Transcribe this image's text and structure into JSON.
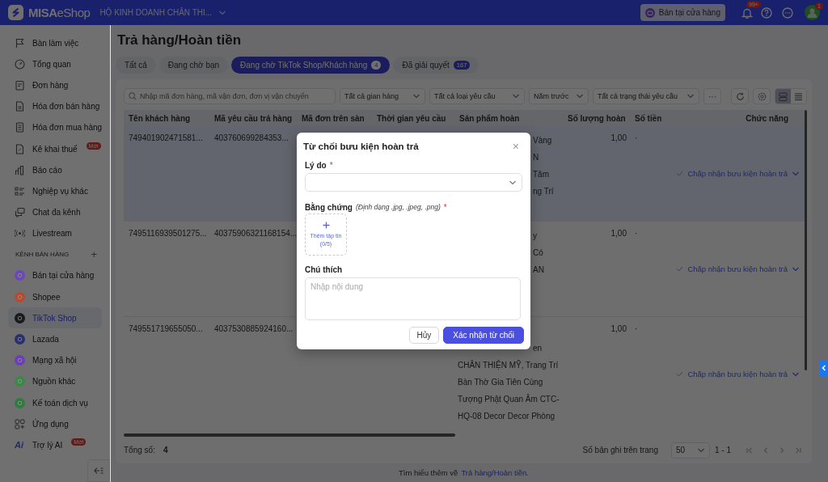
{
  "topbar": {
    "brand": "**MISA**eShop",
    "business": "HỘ KINH DOANH CHÂN THI...",
    "store_button": "Bán tại cửa hàng",
    "notification_count": "99+",
    "avatar_badge": "1"
  },
  "sidebar": {
    "items": [
      {
        "label": "Bàn làm việc",
        "selected": false
      },
      {
        "label": "Tổng quan",
        "selected": false
      },
      {
        "label": "Đơn hàng",
        "selected": false
      },
      {
        "label": "Hóa đơn bán hàng",
        "selected": false
      },
      {
        "label": "Hóa đơn mua hàng",
        "selected": false
      },
      {
        "label": "Kê khai thuế",
        "selected": false,
        "badge": "Mới"
      },
      {
        "label": "Báo cáo",
        "selected": false
      },
      {
        "label": "Nghiệp vụ khác",
        "selected": false
      },
      {
        "label": "Chat đa kênh",
        "selected": false
      },
      {
        "label": "Livestream",
        "selected": false
      }
    ],
    "section_label": "KÊNH BÁN HÀNG",
    "section_action": "+",
    "channels": [
      {
        "label": "Bán tại cửa hàng",
        "kind": "channel",
        "color": "#6b48b8",
        "selected": false
      },
      {
        "label": "Shopee",
        "kind": "channel",
        "color": "#b84a30",
        "selected": false
      },
      {
        "label": "TikTok Shop",
        "kind": "channel",
        "color": "#1a1a1a",
        "selected": true
      },
      {
        "label": "Lazada",
        "kind": "channel",
        "color": "#2a2f6e",
        "selected": false
      },
      {
        "label": "Mạng xã hội",
        "kind": "channel",
        "color": "#6c3fb8",
        "selected": false
      },
      {
        "label": "Nguồn khác",
        "kind": "channel",
        "color": "#3a8a45",
        "selected": false
      },
      {
        "label": "Kế toán dịch vụ",
        "kind": "channel",
        "color": "#2f7d3e",
        "selected": false
      },
      {
        "label": "Ứng dụng",
        "kind": "apps",
        "selected": false
      },
      {
        "label": "Trợ lý AI",
        "kind": "ai",
        "icon_text": "Ai",
        "selected": false,
        "badge": "Mới"
      }
    ]
  },
  "page": {
    "title": "Trả hàng/Hoàn tiền",
    "tabs": [
      {
        "label": "Tất cả",
        "selected": false
      },
      {
        "label": "Đang chờ bạn",
        "selected": false
      },
      {
        "label": "Đang chờ TikTok Shop/Khách hàng",
        "count": "4",
        "selected": true
      },
      {
        "label": "Đã giải quyết",
        "count": "167",
        "selected": false
      }
    ],
    "filters": {
      "search_placeholder": "Nhập mã đơn hàng, mã vận đơn, đơn vị vận chuyển",
      "selects": [
        "Tất cả gian hàng",
        "Tất cả loại yêu cầu",
        "Năm trước",
        "Tất cả trạng thái yêu cầu"
      ],
      "more": "···"
    },
    "view_modes": [
      {
        "selected": true
      },
      {
        "selected": false
      }
    ],
    "table": {
      "columns": [
        "Tên khách hàng",
        "Mã yêu cầu trả hàng",
        "Mã đơn trên sàn",
        "Thời gian yêu cầu",
        "Sản phẩm hoàn",
        "Số lượng hoàn",
        "Số tiền",
        "Chức năng"
      ],
      "rows": [
        {
          "selected": true,
          "customer": "749401902471581...",
          "request_id": "403760699284353...",
          "product_lines": [
            {
              "text": "Vàng",
              "kind": "fragment"
            },
            {
              "text": "N",
              "kind": "fragment"
            },
            {
              "text": "Tâm",
              "kind": "fragment"
            },
            {
              "text": "ng Trí",
              "kind": "fragment"
            }
          ],
          "quantity": "1,00",
          "amount": "·",
          "action": "Chấp nhận bưu kiện hoàn trả"
        },
        {
          "selected": false,
          "customer": "7495116939501275...",
          "request_id": "40375906321168154...",
          "product_lines": [
            {
              "text": "y",
              "kind": "fragment"
            },
            {
              "text": "Có",
              "kind": "fragment"
            },
            {
              "text": "AN",
              "kind": "fragment"
            }
          ],
          "quantity": "1,00",
          "amount": "·",
          "action": "Chấp nhận bưu kiện hoàn trả"
        },
        {
          "selected": false,
          "customer": "749551719655050...",
          "request_id": "4037530885924160...",
          "product_lines": [
            {
              "text": "en",
              "kind": "continued"
            },
            {
              "text": "CHÂN THIỆN MỸ, Trang Trí",
              "kind": "full"
            },
            {
              "text": "Bàn Thờ Gia Tiên Cùng",
              "kind": "full"
            },
            {
              "text": "Tượng Phật Quan Âm CTC-",
              "kind": "full"
            },
            {
              "text": "HQ-08 Decor Decor Phòng",
              "kind": "full"
            }
          ],
          "quantity": "1,00",
          "amount": "·",
          "action": "Chấp nhận bưu kiện hoàn trả"
        }
      ]
    },
    "total_label": "Tổng số:",
    "total": "4",
    "page_size_label": "Số bản ghi trên trang",
    "page_size": "50",
    "range": "1 - 1"
  },
  "help": {
    "text": "Tìm hiểu thêm về",
    "link": "Trả hàng/Hoàn tiền."
  },
  "dialog": {
    "title": "Từ chối bưu kiện hoàn trả",
    "close": "×",
    "reason_label": "Lý do",
    "reason_mark": "*",
    "evidence_label": "Bằng chứng",
    "evidence_hint": "(Định dạng .jpg, .jpeg, .png)",
    "evidence_mark": "*",
    "upload_label": "Thêm tập tin",
    "upload_count": "(0/5)",
    "note_label": "Chú thích",
    "note_placeholder": "Nhập nội dung",
    "buttons": [
      {
        "label": "Hủy",
        "kind": "secondary"
      },
      {
        "label": "Xác nhận từ chối",
        "kind": "primary"
      }
    ]
  }
}
